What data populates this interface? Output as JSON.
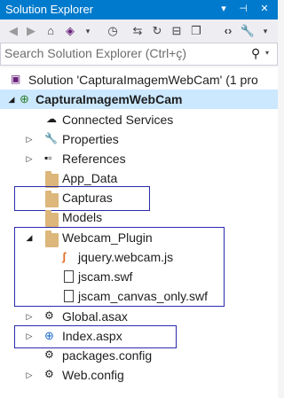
{
  "window": {
    "title": "Solution Explorer",
    "titlebar_icons": [
      "dropdown-icon",
      "pin-icon",
      "close-icon"
    ]
  },
  "toolbar": {
    "buttons": [
      "back-icon",
      "forward-icon",
      "home-icon",
      "vs-icon",
      "history-icon",
      "sync-icon",
      "refresh-icon",
      "collapse-icon",
      "copy-icon",
      "code-icon",
      "wrench-icon"
    ]
  },
  "search": {
    "placeholder": "Search Solution Explorer (Ctrl+ç)"
  },
  "tree": {
    "solution": "Solution 'CapturaImagemWebCam' (1 pro",
    "project": "CapturaImagemWebCam",
    "items": [
      {
        "label": "Connected Services",
        "icon": "cloud-icon"
      },
      {
        "label": "Properties",
        "icon": "wrench-icon"
      },
      {
        "label": "References",
        "icon": "references-icon"
      },
      {
        "label": "App_Data",
        "icon": "folder-icon"
      },
      {
        "label": "Capturas",
        "icon": "folder-icon"
      },
      {
        "label": "Models",
        "icon": "folder-icon"
      },
      {
        "label": "Webcam_Plugin",
        "icon": "folder-icon"
      },
      {
        "label": "jquery.webcam.js",
        "icon": "js-file-icon"
      },
      {
        "label": "jscam.swf",
        "icon": "file-icon"
      },
      {
        "label": "jscam_canvas_only.swf",
        "icon": "file-icon"
      },
      {
        "label": "Global.asax",
        "icon": "asax-icon"
      },
      {
        "label": "Index.aspx",
        "icon": "web-page-icon"
      },
      {
        "label": "packages.config",
        "icon": "config-icon"
      },
      {
        "label": "Web.config",
        "icon": "config-icon"
      }
    ]
  },
  "colors": {
    "accent": "#007acc",
    "selection": "#cce8ff",
    "highlight_box": "#2b2baf"
  }
}
